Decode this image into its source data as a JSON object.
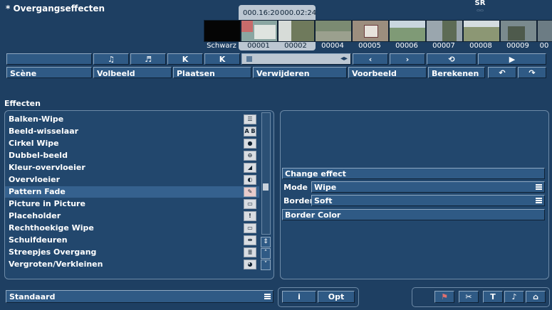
{
  "window": {
    "title": "* Overgangseffecten",
    "logo_text": "SR"
  },
  "timeline": {
    "time_a": "000.16:20",
    "time_b": "000.02:24",
    "clips": [
      {
        "label": "Schwarz",
        "color": "#050505"
      },
      {
        "label": "00001",
        "color": "#8aa6a2",
        "selected": true
      },
      {
        "label": "00002",
        "color": "#6f7a5c",
        "selected": true
      },
      {
        "label": "00004",
        "color": "#7b8b72"
      },
      {
        "label": "00005",
        "color": "#9c8e7e"
      },
      {
        "label": "00006",
        "color": "#7f9a76"
      },
      {
        "label": "00007",
        "color": "#9aa6ae"
      },
      {
        "label": "00008",
        "color": "#8c9774"
      },
      {
        "label": "00009",
        "color": "#7a8a8e"
      },
      {
        "label": "00",
        "color": "#6c7c84"
      }
    ]
  },
  "controls": {
    "play_label": "",
    "buttons": [
      "♫",
      "♬",
      "K",
      "K",
      "‹",
      "›",
      "⟲",
      "▶"
    ]
  },
  "menu": {
    "items": [
      "Scène",
      "Volbeeld",
      "Plaatsen",
      "Verwijderen",
      "Voorbeeld",
      "Berekenen"
    ],
    "undo_icon": "undo-icon",
    "redo_icon": "redo-icon"
  },
  "effects": {
    "title": "Effecten",
    "items": [
      {
        "label": "Balken-Wipe",
        "icon": "bars-icon"
      },
      {
        "label": "Beeld-wisselaar",
        "icon": "ab-icon"
      },
      {
        "label": "Cirkel Wipe",
        "icon": "circle-icon"
      },
      {
        "label": "Dubbel-beeld",
        "icon": "double-icon"
      },
      {
        "label": "Kleur-overvloeier",
        "icon": "color-fade-icon"
      },
      {
        "label": "Overvloeier",
        "icon": "fade-icon"
      },
      {
        "label": "Pattern Fade",
        "icon": "pattern-icon",
        "selected": true
      },
      {
        "label": "Picture in Picture",
        "icon": "pip-icon"
      },
      {
        "label": "Placeholder",
        "icon": "exclaim-icon"
      },
      {
        "label": "Rechthoekige Wipe",
        "icon": "rect-icon"
      },
      {
        "label": "Schuifdeuren",
        "icon": "doors-icon"
      },
      {
        "label": "Streepjes Overgang",
        "icon": "stripes-icon"
      },
      {
        "label": "Vergroten/Verkleinen",
        "icon": "zoom-icon"
      }
    ]
  },
  "details": {
    "change_effect": "Change effect",
    "mode_label": "Mode",
    "mode_value": "Wipe",
    "border_label": "Border",
    "border_value": "Soft",
    "border_color": "Border Color"
  },
  "bottom": {
    "preset": "Standaard",
    "info_label": "i",
    "opt_label": "Opt",
    "group_icons": [
      "flag-icon",
      "scissors-icon",
      "title-icon",
      "audio-icon",
      "home-icon"
    ]
  }
}
